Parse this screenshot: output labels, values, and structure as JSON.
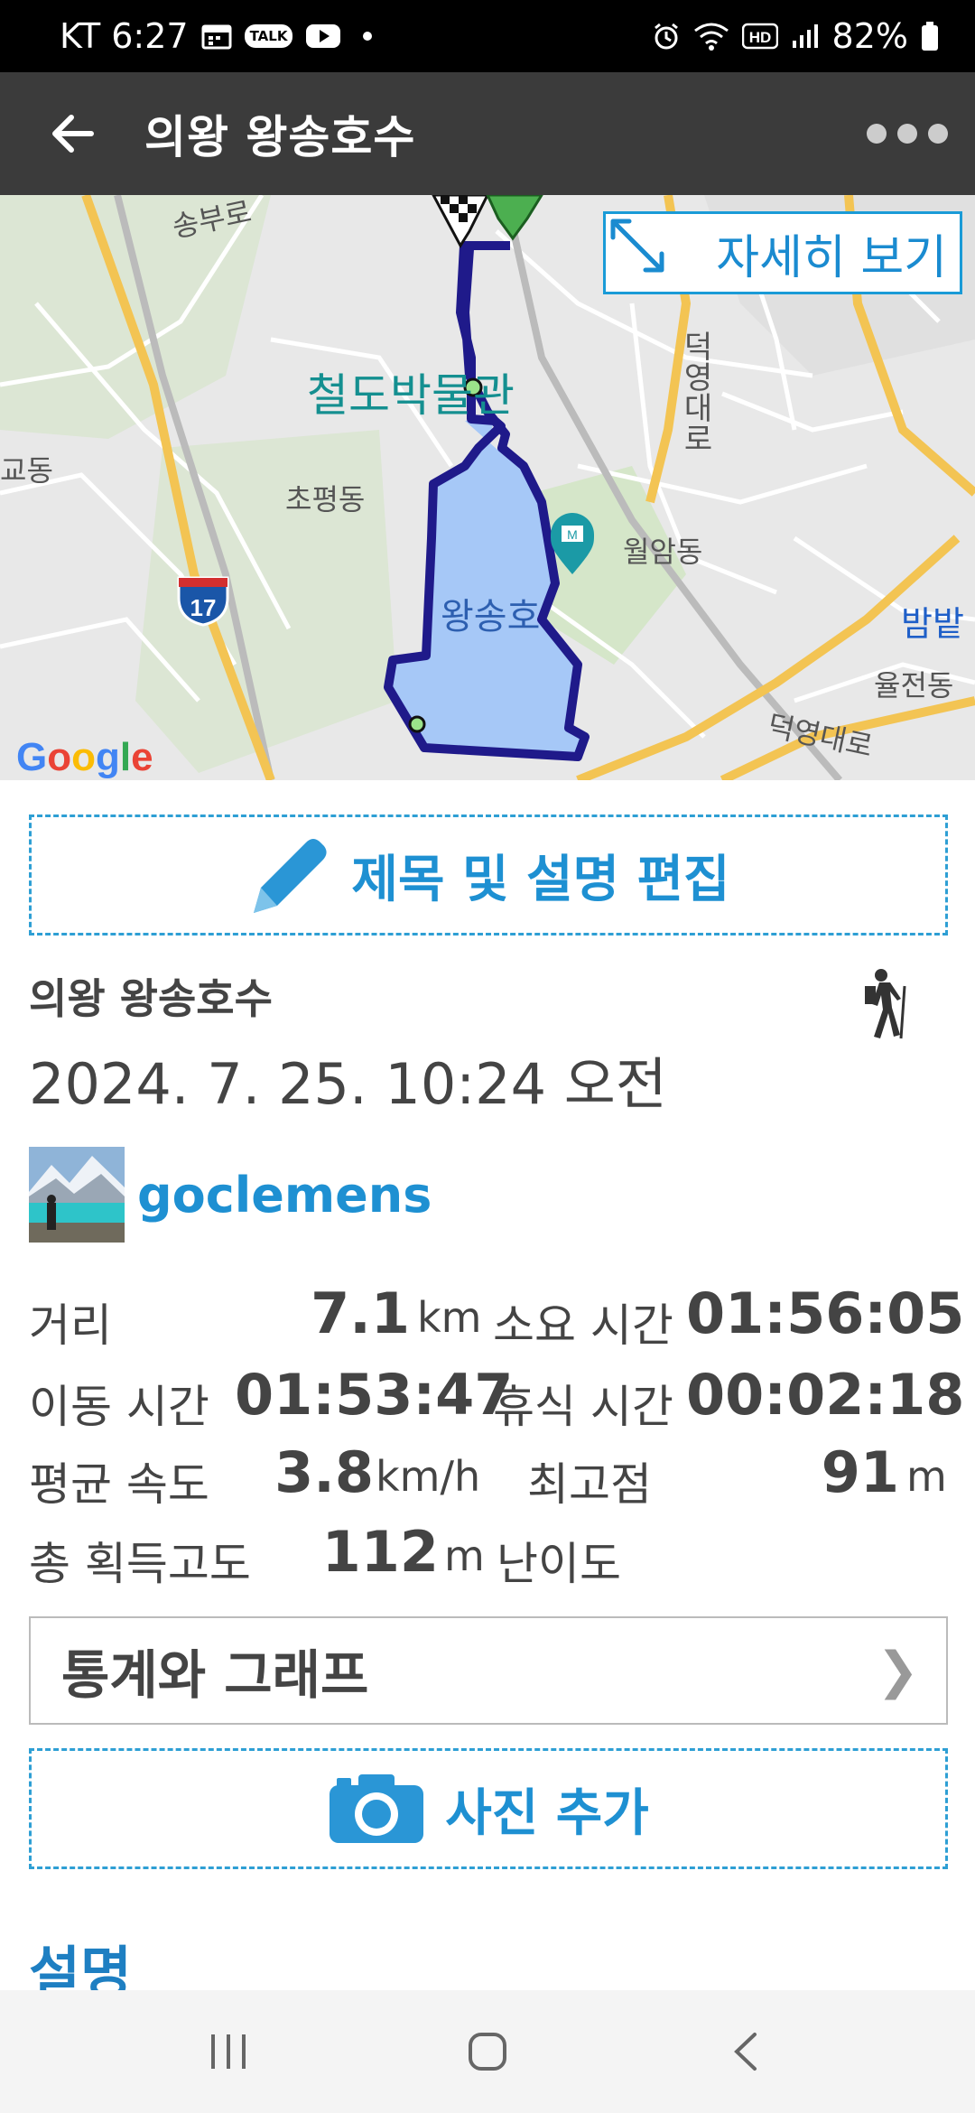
{
  "status_bar": {
    "carrier_time": "KT 6:27",
    "talk_badge": "TALK",
    "hd_badge": "HD",
    "battery": "82%",
    "icons": [
      "calendar-icon",
      "talk-icon",
      "youtube-icon",
      "dot-icon",
      "alarm-icon",
      "wifi-icon",
      "hd-icon",
      "signal-icon",
      "battery-icon"
    ]
  },
  "app_bar": {
    "title": "의왕 왕송호수",
    "back_icon": "back-arrow-icon",
    "more_icon": "more-dots-icon"
  },
  "map": {
    "detail_button": "자세히 보기",
    "attribution": "Google",
    "labels": {
      "songbu": "송부로",
      "museum": "철도박물관",
      "deokyeong_vertical": "덕영대로",
      "gyodong": "교동",
      "chopyeong": "초평동",
      "wolam": "월암동",
      "lake": "왕송호",
      "bambat": "밤밭",
      "yuljeon": "율전동",
      "deokyeong": "덕영대로",
      "highway": "17"
    },
    "route_color": "#1f1a8a",
    "lake_color": "#a6c8f7"
  },
  "edit_button": "제목 및 설명 편집",
  "track": {
    "name": "의왕 왕송호수",
    "datetime": "2024. 7. 25. 10:24 오전",
    "activity_icon": "hiking-icon"
  },
  "user": {
    "name": "goclemens"
  },
  "stats": {
    "distance": {
      "label": "거리",
      "value": "7.1",
      "unit": "km"
    },
    "total_time": {
      "label": "소요 시간",
      "value": "01:56:05"
    },
    "moving_time": {
      "label": "이동 시간",
      "value": "01:53:47"
    },
    "rest_time": {
      "label": "휴식 시간",
      "value": "00:02:18"
    },
    "avg_speed": {
      "label": "평균 속도",
      "value": "3.8",
      "unit": "km/h"
    },
    "max_altitude": {
      "label": "최고점",
      "value": "91",
      "unit": "m"
    },
    "elevation_gain": {
      "label": "총 획득고도",
      "value": "112",
      "unit": "m"
    },
    "difficulty": {
      "label": "난이도"
    }
  },
  "stats_link": {
    "label": "통계와 그래프",
    "chevron": "❯"
  },
  "photo_button": "사진 추가",
  "description_title": "설명",
  "nav": {
    "icons": [
      "recent-apps-icon",
      "home-icon",
      "back-icon"
    ]
  },
  "colors": {
    "accent": "#1e90d2",
    "appbar": "#3b3b3b",
    "route": "#1f1a8a"
  }
}
